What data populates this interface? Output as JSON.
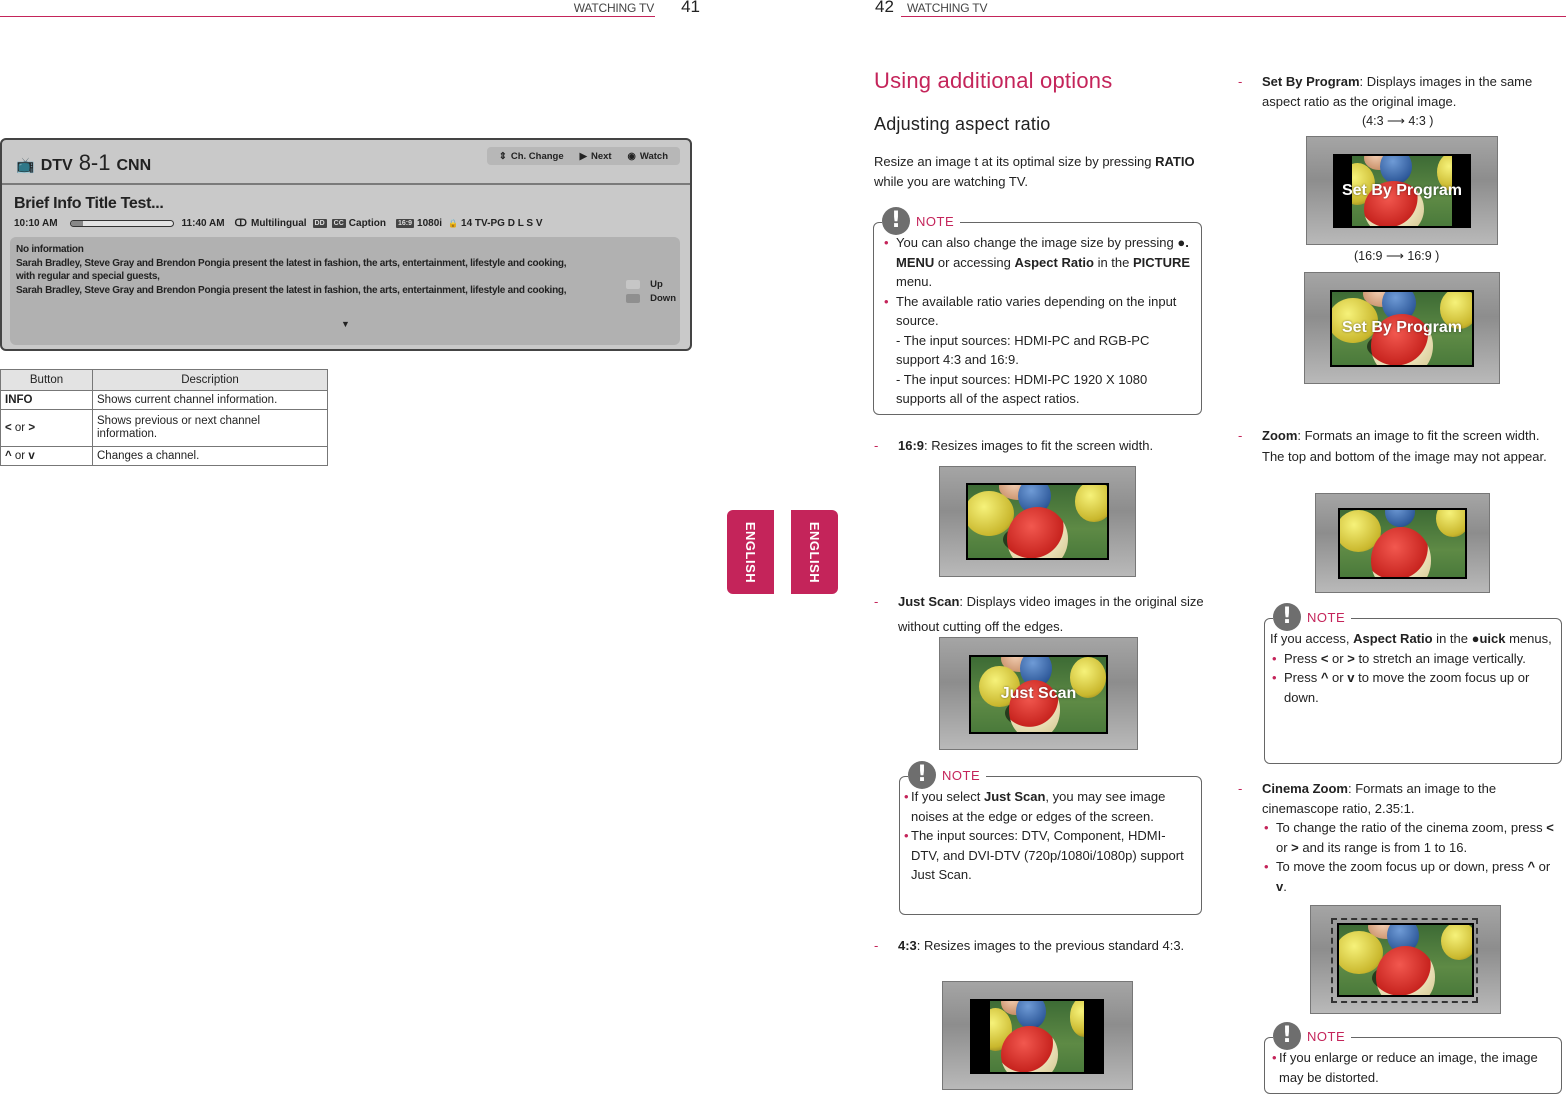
{
  "left_page": {
    "section": "WATCHING TV",
    "page_number": "41",
    "tv_banner": {
      "tv_icon": "📺",
      "source": "DTV",
      "channel_number": "8-1",
      "channel_name": "CNN",
      "keys": [
        {
          "icon": "⇕",
          "label": "Ch. Change"
        },
        {
          "icon": "▶",
          "label": "Next"
        },
        {
          "icon": "◉",
          "label": "Watch"
        }
      ],
      "program_title": "Brief Info Title Test...",
      "start_time": "10:10 AM",
      "end_time": "11:40 AM",
      "progress_percent": 12,
      "audio_icon": "ↀ",
      "audio": "Multilingual",
      "dolby_badge": "DD",
      "cc_badge": "CC",
      "caption": "Caption",
      "ratio_badge": "16:9",
      "resolution": "1080i",
      "lock_icon": "🔒",
      "rating": "14 TV-PG D L S V",
      "description_lines": [
        "No information",
        "Sarah Bradley, Steve Gray and Brendon Pongia present the latest in fashion, the arts, entertainment, lifestyle and cooking,",
        "with regular and special guests,",
        "Sarah Bradley, Steve Gray and Brendon Pongia present the latest in fashion, the arts, entertainment, lifestyle and cooking,"
      ],
      "scroll_up": "Up",
      "scroll_down": "Down",
      "more_icon": "▼"
    },
    "button_table": {
      "headers": [
        "Button",
        "Description"
      ],
      "rows": [
        {
          "button": "INFO",
          "description": "Shows current channel information."
        },
        {
          "button_a": "<",
          "or": " or ",
          "button_b": ">",
          "description": "Shows previous or next channel information."
        },
        {
          "button_a": "^",
          "or": " or ",
          "button_b": "v",
          "description": "Changes a channel."
        }
      ]
    }
  },
  "language_tabs": [
    "ENGLISH",
    "ENGLISH"
  ],
  "right_page": {
    "page_number": "42",
    "section": "WATCHING TV",
    "title": "Using additional options",
    "subtitle": "Adjusting aspect ratio",
    "intro_a": "Resize an image t at its optimal size by pressing ",
    "intro_bold": "RATIO",
    "intro_b": " while you are watching TV.",
    "note_label": "NOTE",
    "note_icon": "!",
    "note1": {
      "b1_a": "You can also change the image size by pressing ",
      "b1_icon": "●",
      "b1_bold1": ". MENU",
      "b1_b": " or accessing ",
      "b1_bold2": "Aspect Ratio",
      "b1_c": " in the ",
      "b1_bold3": "PICTURE",
      "b1_d": " menu.",
      "b2": "The available ratio varies depending on the input source.",
      "sub1": "- The input sources: HDMI-PC and RGB-PC support 4:3 and 16:9.",
      "sub2": "- The input sources: HDMI-PC 1920 X 1080 supports all of the aspect ratios."
    },
    "items": {
      "r169": {
        "dash": "-",
        "name": "16:9",
        "text": ": Resizes images to fit the screen width."
      },
      "just_scan": {
        "dash": "-",
        "name": "Just Scan",
        "text": ": Displays video images in the original size without cutting off the edges.",
        "overlay": "Just Scan"
      },
      "r43": {
        "dash": "-",
        "name": "4:3",
        "text": ": Resizes images to the previous standard 4:3."
      },
      "set_by_program": {
        "dash": "-",
        "name": "Set By Program",
        "text": ": Displays images in the same aspect ratio as the original image.",
        "caption1": "(4:3  ⟶ 4:3 )",
        "caption2": "(16:9  ⟶ 16:9 )",
        "overlay": "Set By Program"
      },
      "zoom": {
        "dash": "-",
        "name": "Zoom",
        "text": ": Formats an image to fit the screen width. The top and bottom of the image may not appear."
      },
      "cinema_zoom": {
        "dash": "-",
        "name": "Cinema Zoom",
        "text": ": Formats an image to the cinemascope ratio, 2.35:1.",
        "b1_a": "To change the ratio of the cinema zoom, press ",
        "b1_k1": "<",
        "b1_or": " or ",
        "b1_k2": ">",
        "b1_b": " and its range is from 1 to 16.",
        "b2_a": "To move the zoom focus up or down, press ",
        "b2_k1": "^",
        "b2_or": " or ",
        "b2_k2": "v",
        "b2_b": "."
      }
    },
    "note2": {
      "b1_a": "If you select ",
      "b1_bold": "Just Scan",
      "b1_b": ", you may see image noises at the edge or edges of the screen.",
      "b2": "The input sources: DTV, Component, HDMI-DTV, and DVI-DTV (720p/1080i/1080p) support Just Scan."
    },
    "note3": {
      "intro_a": "If you access, ",
      "intro_bold": "Aspect Ratio",
      "intro_b": " in the ",
      "intro_icon": "●",
      "intro_bold2": "uick",
      "intro_c": " menus,",
      "b1_a": "Press ",
      "b1_k1": "<",
      "b1_or": " or ",
      "b1_k2": ">",
      "b1_b": " to stretch an image vertically.",
      "b2_a": "Press ",
      "b2_k1": "^",
      "b2_or": " or ",
      "b2_k2": "v",
      "b2_b": " to move the zoom focus up or down."
    },
    "note4": {
      "b1": "If you enlarge or reduce an image, the image may be distorted."
    }
  }
}
